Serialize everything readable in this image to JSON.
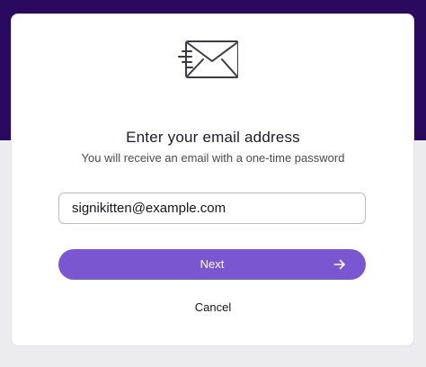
{
  "header": {
    "icon": "mail-fast-icon",
    "title": "Enter your email address",
    "subtitle": "You will receive an email with a one-time password"
  },
  "form": {
    "email_value": "signikitten@example.com",
    "next_label": "Next",
    "next_icon": "arrow-right-icon",
    "cancel_label": "Cancel"
  },
  "colors": {
    "brand_dark": "#2a0a5e",
    "accent": "#7a56d0",
    "background": "#ececef"
  }
}
